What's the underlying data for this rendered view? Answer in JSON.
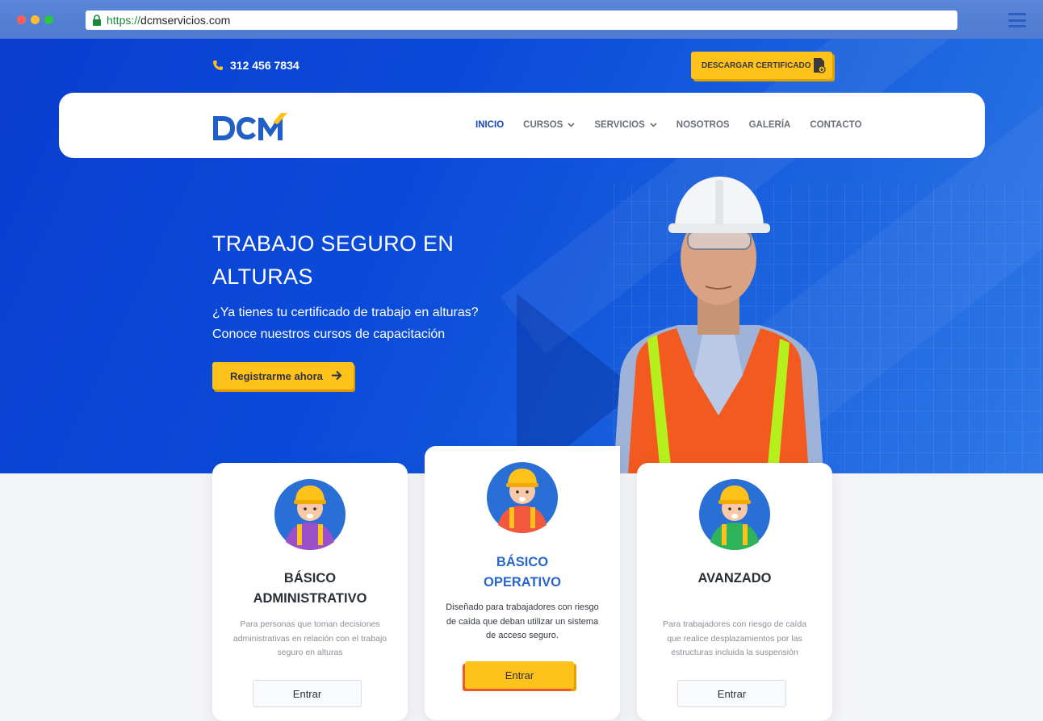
{
  "browser": {
    "url_scheme": "https://",
    "url_host": "dcmservicios.com"
  },
  "topbar": {
    "phone": "312 456 7834",
    "cert_button": "DESCARGAR CERTIFICADO"
  },
  "logo": {
    "text": "DCM"
  },
  "nav": {
    "items": [
      {
        "label": "INICIO",
        "active": true
      },
      {
        "label": "CURSOS",
        "dropdown": true
      },
      {
        "label": "SERVICIOS",
        "dropdown": true
      },
      {
        "label": "NOSOTROS"
      },
      {
        "label": "GALERÍA"
      },
      {
        "label": "CONTACTO"
      }
    ]
  },
  "hero": {
    "title_line1": "TRABAJO SEGURO EN",
    "title_line2": "ALTURAS",
    "sub_line1": "¿Ya tienes tu certificado de trabajo en alturas?",
    "sub_line2": "Conoce nuestros cursos de capacitación",
    "cta": "Registrarme ahora"
  },
  "cards": [
    {
      "title_line1": "BÁSICO",
      "title_line2": "ADMINISTRATIVO",
      "desc": "Para personas que toman decisiones administrativas en relación con el trabajo seguro en alturas",
      "button": "Entrar"
    },
    {
      "title_line1": "BÁSICO",
      "title_line2": "OPERATIVO",
      "desc": "Diseñado para trabajadores con riesgo de caída que deban utilizar un sistema de acceso seguro.",
      "button": "Entrar"
    },
    {
      "title_line1": "AVANZADO",
      "title_line2": "",
      "desc": "Para trabajadores con riesgo de caída que realice desplazamientos por las estructuras incluida la suspensión",
      "button": "Entrar"
    }
  ],
  "colors": {
    "brand_blue": "#1f5fc6",
    "accent_yellow": "#ffc21a",
    "hero_blue": "#0b4bd9"
  }
}
